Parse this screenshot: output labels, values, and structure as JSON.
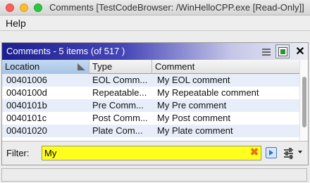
{
  "window": {
    "title": "Comments [TestCodeBrowser: /WinHelloCPP.exe [Read-Only]]"
  },
  "menu": {
    "help": "Help"
  },
  "panel": {
    "title": "Comments - 5 items (of 517 )",
    "icons": [
      "lines-icon",
      "toggle-icon",
      "close-icon"
    ],
    "close_glyph": "✕"
  },
  "table": {
    "columns": [
      "Location",
      "Type",
      "Comment"
    ],
    "sort_column": "Location",
    "rows": [
      {
        "location": "00401006",
        "type": "EOL Comm...",
        "comment": "My EOL comment"
      },
      {
        "location": "0040100d",
        "type": "Repeatable...",
        "comment": "My Repeatable comment"
      },
      {
        "location": "0040101b",
        "type": "Pre Comm...",
        "comment": "My Pre comment"
      },
      {
        "location": "0040101c",
        "type": "Post Comm...",
        "comment": "My Post comment"
      },
      {
        "location": "00401020",
        "type": "Plate Com...",
        "comment": "My Plate comment"
      }
    ]
  },
  "filter": {
    "label": "Filter:",
    "value": "My",
    "clear_glyph": "✖"
  },
  "colors": {
    "filter_bg": "#ffff1e",
    "header_gradient_start": "#1d1f8e",
    "row_alt": "#e7eef9",
    "sorted_column": "#b7cfeb"
  }
}
